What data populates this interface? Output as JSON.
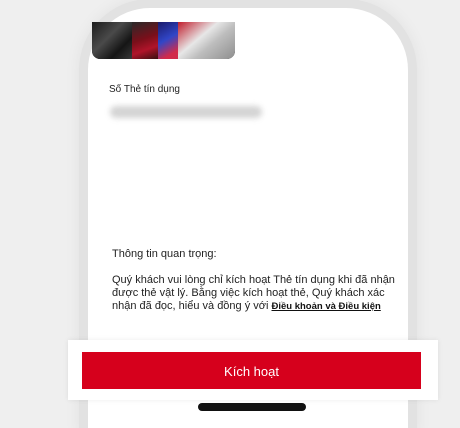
{
  "card": {
    "label": "Số Thẻ tín dụng"
  },
  "info": {
    "title": "Thông tin quan trọng:",
    "body_prefix": "Quý khách vui lòng chỉ kích hoạt Thẻ tín dụng khi đã nhận được thẻ vật lý. Bằng việc kích hoạt thẻ, Quý khách xác nhận đã đọc, hiểu và đồng ý với ",
    "terms_link": "Điều khoản và Điều kiện"
  },
  "actions": {
    "activate_label": "Kích hoạt"
  },
  "colors": {
    "primary": "#d6001c",
    "background": "#efefef"
  }
}
